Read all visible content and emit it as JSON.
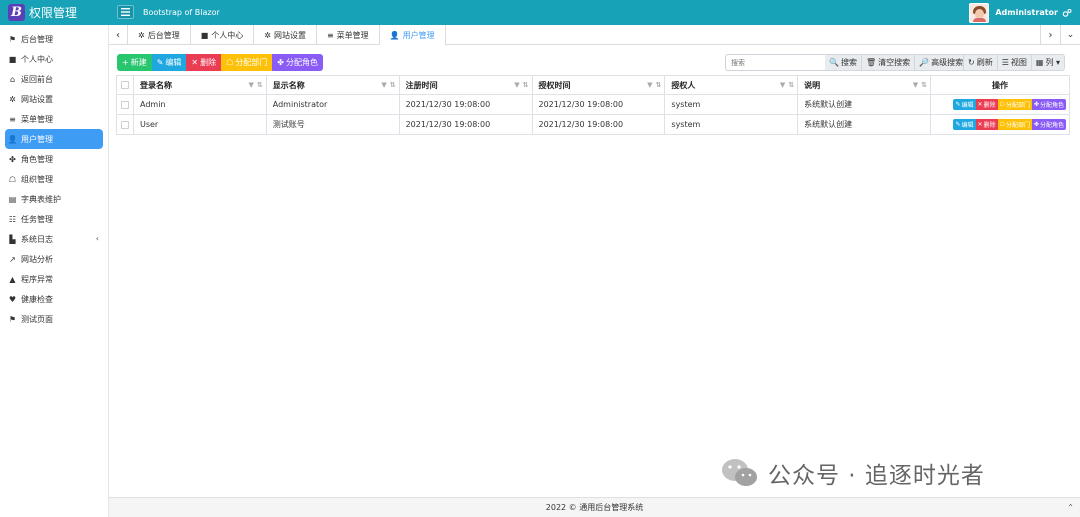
{
  "header": {
    "brand_title": "权限管理",
    "brand_logo_letter": "B",
    "subtitle": "Bootstrap of Blazor",
    "user_name": "Administrator",
    "bg_color": "#17a2b8"
  },
  "sidebar": {
    "items": [
      {
        "label": "后台管理",
        "icon": "flag-icon",
        "glyph": "⚑"
      },
      {
        "label": "个人中心",
        "icon": "briefcase-icon",
        "glyph": "■"
      },
      {
        "label": "返回前台",
        "icon": "home-icon",
        "glyph": "⌂"
      },
      {
        "label": "网站设置",
        "icon": "gear-icon",
        "glyph": "✲"
      },
      {
        "label": "菜单管理",
        "icon": "bars-icon",
        "glyph": "≡"
      },
      {
        "label": "用户管理",
        "icon": "user-cog-icon",
        "glyph": "👤",
        "active": true
      },
      {
        "label": "角色管理",
        "icon": "users-icon",
        "glyph": "✤"
      },
      {
        "label": "组织管理",
        "icon": "sitemap-icon",
        "glyph": "☖"
      },
      {
        "label": "字典表维护",
        "icon": "book-icon",
        "glyph": "▤"
      },
      {
        "label": "任务管理",
        "icon": "tasks-icon",
        "glyph": "☷"
      },
      {
        "label": "系统日志",
        "icon": "log-icon",
        "glyph": "▙",
        "has_chevron": true
      },
      {
        "label": "网站分析",
        "icon": "chart-line-icon",
        "glyph": "↗"
      },
      {
        "label": "程序异常",
        "icon": "warning-icon",
        "glyph": "▲"
      },
      {
        "label": "健康检查",
        "icon": "heartbeat-icon",
        "glyph": "♥"
      },
      {
        "label": "测试页面",
        "icon": "flag-icon",
        "glyph": "⚑"
      }
    ],
    "active_color": "#3f9cf5"
  },
  "tabs": [
    {
      "label": "后台管理",
      "glyph": "✲"
    },
    {
      "label": "个人中心",
      "glyph": "■"
    },
    {
      "label": "网站设置",
      "glyph": "✲"
    },
    {
      "label": "菜单管理",
      "glyph": "≡"
    },
    {
      "label": "用户管理",
      "glyph": "👤",
      "active": true
    }
  ],
  "toolbar": {
    "buttons": [
      {
        "label": "新建",
        "glyph": "+",
        "color": "#28c76f",
        "icon": "plus-icon"
      },
      {
        "label": "编辑",
        "glyph": "✎",
        "color": "#1fa8e0",
        "icon": "edit-icon"
      },
      {
        "label": "删除",
        "glyph": "✕",
        "color": "#ea3c53",
        "icon": "delete-icon"
      },
      {
        "label": "分配部门",
        "glyph": "☖",
        "color": "#ffc107",
        "icon": "sitemap-icon"
      },
      {
        "label": "分配角色",
        "glyph": "✤",
        "color": "#8a5cf5",
        "icon": "users-icon"
      }
    ],
    "search_placeholder": "搜索",
    "search_buttons": [
      {
        "label": "搜索",
        "glyph": "🔍",
        "icon": "search-icon"
      },
      {
        "label": "清空搜索",
        "glyph": "🗑",
        "icon": "trash-icon"
      },
      {
        "label": "高级搜索",
        "glyph": "🔎",
        "icon": "advanced-search-icon"
      }
    ],
    "view_buttons": [
      {
        "label": "刷新",
        "glyph": "↻",
        "icon": "refresh-icon"
      },
      {
        "label": "视图",
        "glyph": "☰",
        "icon": "list-icon"
      },
      {
        "label": "列 ▾",
        "glyph": "▦",
        "icon": "columns-icon"
      }
    ]
  },
  "table": {
    "columns": [
      "登录名称",
      "显示名称",
      "注册时间",
      "授权时间",
      "授权人",
      "说明",
      "操作"
    ],
    "rows": [
      {
        "login": "Admin",
        "display": "Administrator",
        "registered": "2021/12/30 19:08:00",
        "approved": "2021/12/30 19:08:00",
        "approver": "system",
        "description": "系统默认创建"
      },
      {
        "login": "User",
        "display": "测试账号",
        "registered": "2021/12/30 19:08:00",
        "approved": "2021/12/30 19:08:00",
        "approver": "system",
        "description": "系统默认创建"
      }
    ],
    "row_actions": [
      {
        "label": "编辑",
        "glyph": "✎",
        "color": "#1fa8e0"
      },
      {
        "label": "删除",
        "glyph": "✕",
        "color": "#ea3c53"
      },
      {
        "label": "分配部门",
        "glyph": "☖",
        "color": "#ffc107"
      },
      {
        "label": "分配角色",
        "glyph": "✤",
        "color": "#8a5cf5"
      }
    ]
  },
  "footer": {
    "text": "2022 © 通用后台管理系统"
  },
  "watermark": {
    "text": "公众号 · 追逐时光者"
  }
}
